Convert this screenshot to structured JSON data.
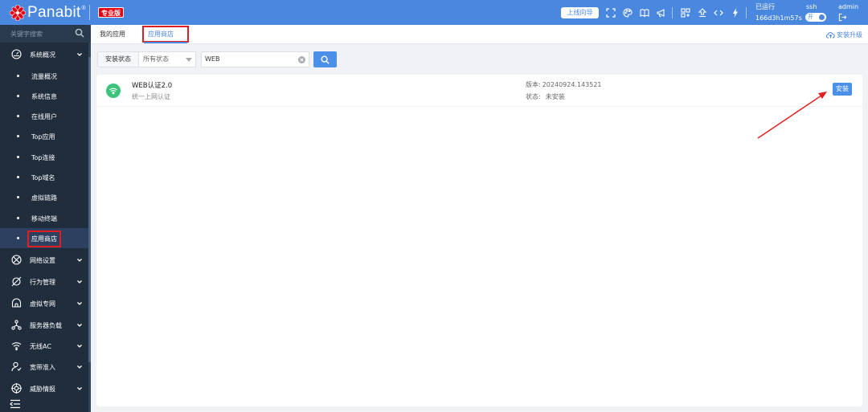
{
  "header": {
    "logo_text": "Panabit",
    "logo_reg": "®",
    "edition_badge": "专业版",
    "wizard_button": "上线向导",
    "uptime_label": "已运行",
    "uptime_value": "166d3h1m57s",
    "ssh_label": "ssh",
    "ssh_toggle": "开",
    "user": "admin",
    "icons": [
      "expand-icon",
      "palette-icon",
      "book-icon",
      "megaphone-icon",
      "grid-icon",
      "upload-icon",
      "code-icon",
      "lightning-icon",
      "logout-icon"
    ]
  },
  "sidebar": {
    "search_placeholder": "关键字搜索",
    "groups": [
      {
        "label": "系统概况",
        "icon": "dashboard-icon"
      },
      {
        "label": "网络设置",
        "icon": "network-icon"
      },
      {
        "label": "行为管理",
        "icon": "behavior-icon"
      },
      {
        "label": "虚拟专网",
        "icon": "vpn-icon"
      },
      {
        "label": "服务器负载",
        "icon": "server-load-icon"
      },
      {
        "label": "无线AC",
        "icon": "wifi-icon"
      },
      {
        "label": "宽带准入",
        "icon": "user-access-icon"
      },
      {
        "label": "威胁情报",
        "icon": "threat-icon"
      }
    ],
    "sub_items": [
      "流量概况",
      "系统信息",
      "在线用户",
      "Top应用",
      "Top连接",
      "Top域名",
      "虚拟链路",
      "移动终端",
      "应用商店"
    ],
    "active_item": "应用商店"
  },
  "main": {
    "tabs": [
      "我的应用",
      "应用商店"
    ],
    "active_tab": "应用商店",
    "upgrade_link": "安装升级",
    "filter": {
      "label": "安装状态",
      "select_value": "所有状态",
      "search_value": "WEB"
    },
    "apps": [
      {
        "name": "WEB认证2.0",
        "desc": "统一上网认证",
        "version_label": "版本:",
        "version": "20240924.143521",
        "status_label": "状态:",
        "status": "未安装",
        "install_label": "安装"
      }
    ]
  },
  "colors": {
    "header_bg": "#4a87df",
    "sidebar_bg": "#1f2d3d",
    "accent": "#4a90e8",
    "highlight": "#e02020",
    "app_icon": "#3cc47c"
  }
}
